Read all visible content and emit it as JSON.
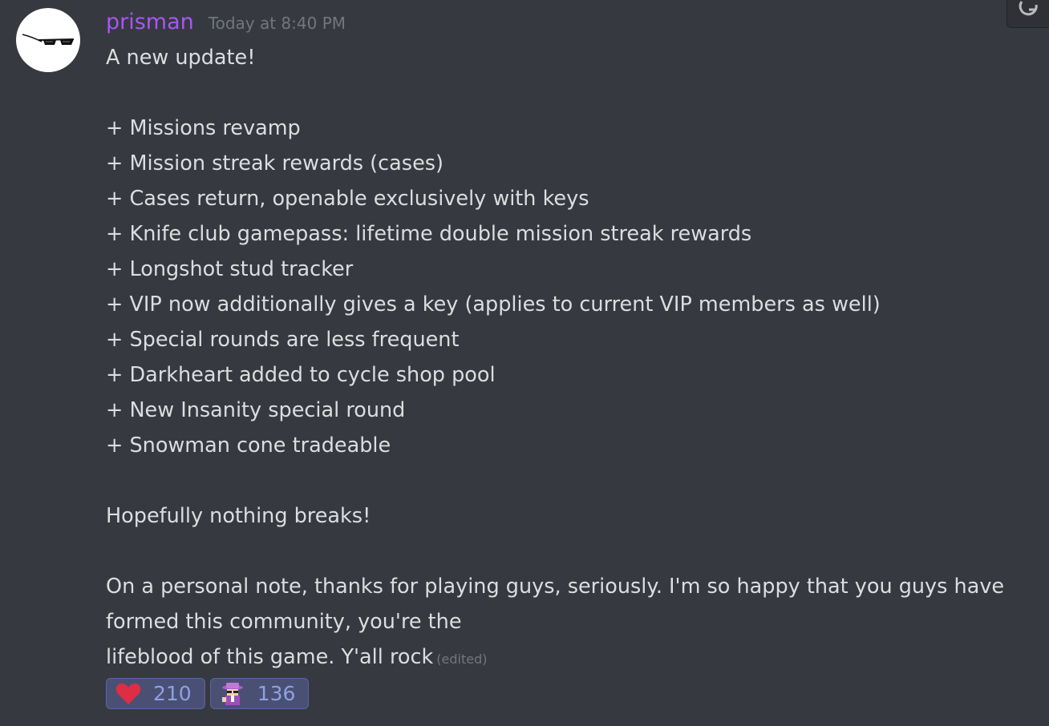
{
  "message": {
    "author": "prisman",
    "timestamp": "Today at 8:40 PM",
    "edited_label": "(edited)",
    "colors": {
      "username": "#a855f7",
      "background": "#36393f",
      "text": "#dcddde",
      "muted": "#72767d",
      "reaction_bg": "#4a5074",
      "reaction_count": "#8ea1e1"
    },
    "lines": [
      "A new update!",
      "",
      "+ Missions revamp",
      "+ Mission streak rewards (cases)",
      "+ Cases return, openable exclusively with keys",
      "+ Knife club gamepass: lifetime double mission streak rewards",
      "+ Longshot stud tracker",
      "+ VIP now additionally gives a key (applies to current VIP members as well)",
      "+ Special rounds are less frequent",
      "+ Darkheart added to cycle shop pool",
      "+ New Insanity special round",
      "+ Snowman cone tradeable",
      "",
      "Hopefully nothing breaks!",
      "",
      "On a personal note, thanks for playing guys, seriously. I'm so happy that you guys have formed this community, you're the",
      "lifeblood of this game. Y'all rock"
    ],
    "reactions": [
      {
        "emoji": "heart-emoji",
        "count": "210"
      },
      {
        "emoji": "spy-character-emoji",
        "count": "136"
      }
    ]
  },
  "icons": {
    "avatar": "sunglasses-avatar-icon",
    "corner": "add-reaction-icon"
  }
}
